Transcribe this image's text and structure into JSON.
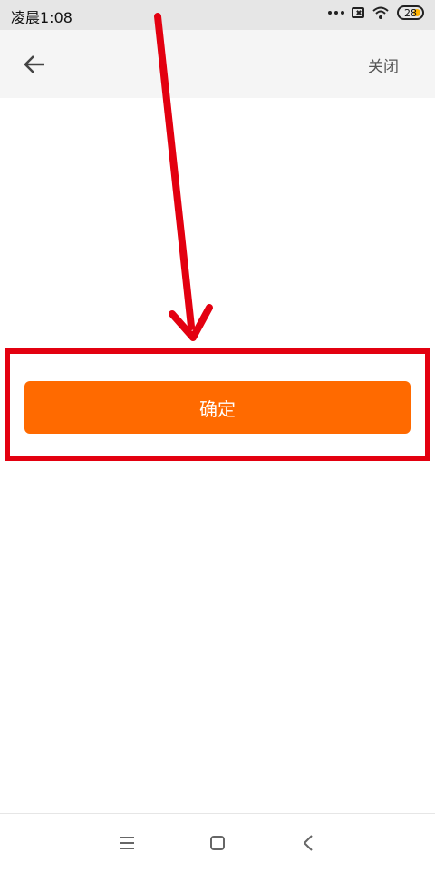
{
  "status_bar": {
    "time": "凌晨1:08",
    "battery_level": "28",
    "battery_color": "#ffb300"
  },
  "nav": {
    "back_icon": "arrow-left-icon",
    "close_label": "关闭"
  },
  "main": {
    "confirm_label": "确定",
    "confirm_color": "#ff6a00"
  },
  "annotation": {
    "color": "#e30010",
    "arrow_icon": "annotation-arrow-icon"
  },
  "system_nav": {
    "menu_icon": "menu-icon",
    "home_icon": "home-square-icon",
    "back_icon": "chevron-left-icon"
  }
}
